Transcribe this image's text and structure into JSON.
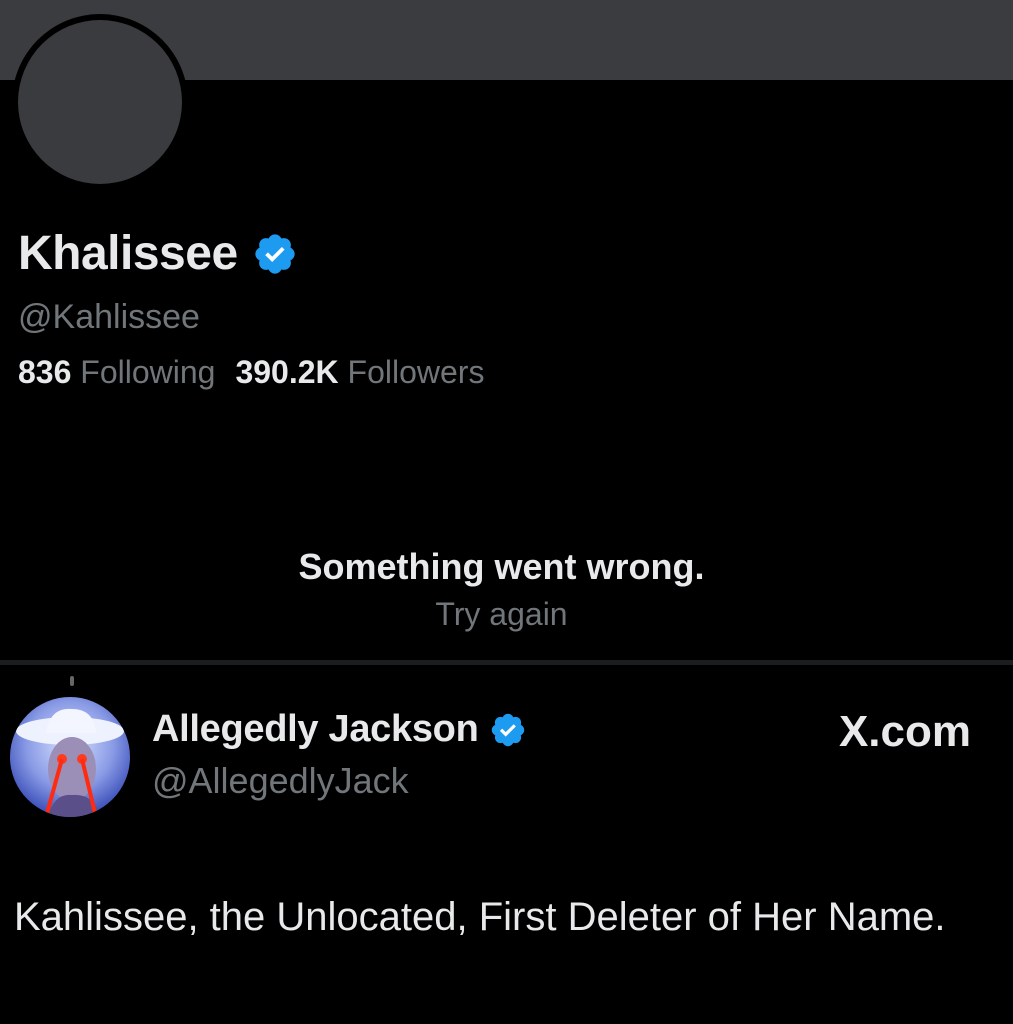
{
  "profile": {
    "display_name": "Khalissee",
    "handle": "@Kahlissee",
    "following_count": "836",
    "following_label": "Following",
    "followers_count": "390.2K",
    "followers_label": "Followers",
    "verified_icon": "verified-badge-icon"
  },
  "error": {
    "title": "Something went wrong.",
    "retry": "Try again"
  },
  "tweet": {
    "author_name": "Allegedly Jackson",
    "author_handle": "@AllegedlyJack",
    "site_label": "X.com",
    "text": "Kahlissee, the Unlocated, First Deleter of Her Name."
  },
  "colors": {
    "background": "#000000",
    "banner": "#3b3c3f",
    "primary_text": "#e7e9ea",
    "secondary_text": "#71767b",
    "verified_blue": "#1d9bf0"
  }
}
